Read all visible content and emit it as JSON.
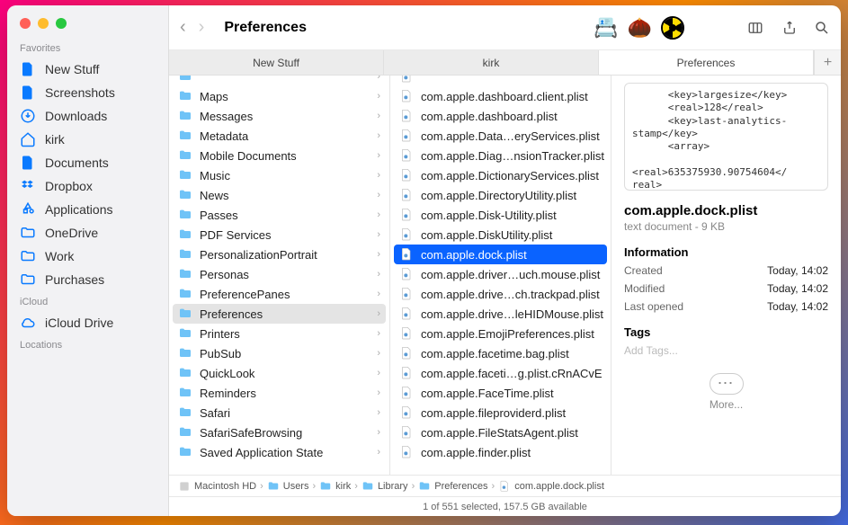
{
  "window_title": "Preferences",
  "sidebar": {
    "sections": [
      {
        "label": "Favorites",
        "items": [
          {
            "icon": "doc",
            "label": "New Stuff"
          },
          {
            "icon": "doc",
            "label": "Screenshots"
          },
          {
            "icon": "download",
            "label": "Downloads"
          },
          {
            "icon": "home",
            "label": "kirk"
          },
          {
            "icon": "doc",
            "label": "Documents"
          },
          {
            "icon": "dropbox",
            "label": "Dropbox"
          },
          {
            "icon": "app",
            "label": "Applications"
          },
          {
            "icon": "folder",
            "label": "OneDrive"
          },
          {
            "icon": "folder",
            "label": "Work"
          },
          {
            "icon": "folder",
            "label": "Purchases"
          }
        ]
      },
      {
        "label": "iCloud",
        "items": [
          {
            "icon": "cloud",
            "label": "iCloud Drive"
          }
        ]
      },
      {
        "label": "Locations",
        "items": []
      }
    ]
  },
  "toolbar": {
    "apps": [
      "scanner",
      "acorn",
      "radiation"
    ]
  },
  "tabs": [
    {
      "label": "New Stuff",
      "active": false
    },
    {
      "label": "kirk",
      "active": false
    },
    {
      "label": "Preferences",
      "active": true
    }
  ],
  "columns": {
    "folders": [
      "Maps",
      "Messages",
      "Metadata",
      "Mobile Documents",
      "Music",
      "News",
      "Passes",
      "PDF Services",
      "PersonalizationPortrait",
      "Personas",
      "PreferencePanes",
      "Preferences",
      "Printers",
      "PubSub",
      "QuickLook",
      "Reminders",
      "Safari",
      "SafariSafeBrowsing",
      "Saved Application State"
    ],
    "folders_selected_index": 11,
    "files": [
      "com.apple.dashboard.client.plist",
      "com.apple.dashboard.plist",
      "com.apple.Data…eryServices.plist",
      "com.apple.Diag…nsionTracker.plist",
      "com.apple.DictionaryServices.plist",
      "com.apple.DirectoryUtility.plist",
      "com.apple.Disk-Utility.plist",
      "com.apple.DiskUtility.plist",
      "com.apple.dock.plist",
      "com.apple.driver…uch.mouse.plist",
      "com.apple.drive…ch.trackpad.plist",
      "com.apple.drive…leHIDMouse.plist",
      "com.apple.EmojiPreferences.plist",
      "com.apple.facetime.bag.plist",
      "com.apple.faceti…g.plist.cRnACvE",
      "com.apple.FaceTime.plist",
      "com.apple.fileproviderd.plist",
      "com.apple.FileStatsAgent.plist",
      "com.apple.finder.plist"
    ],
    "files_selected_index": 8
  },
  "preview": {
    "raw": "      <key>largesize</key>\n      <real>128</real>\n      <key>last-analytics-\nstamp</key>\n      <array>\n\n<real>635375930.90754604</\nreal>\n      </array>\n      <key>last-",
    "title": "com.apple.dock.plist",
    "subtitle": "text document - 9 KB",
    "info_label": "Information",
    "created_label": "Created",
    "created_value": "Today, 14:02",
    "modified_label": "Modified",
    "modified_value": "Today, 14:02",
    "opened_label": "Last opened",
    "opened_value": "Today, 14:02",
    "tags_label": "Tags",
    "tags_placeholder": "Add Tags...",
    "more_label": "More..."
  },
  "path": [
    {
      "icon": "disk",
      "label": "Macintosh HD"
    },
    {
      "icon": "folder",
      "label": "Users"
    },
    {
      "icon": "folder",
      "label": "kirk"
    },
    {
      "icon": "folder",
      "label": "Library"
    },
    {
      "icon": "folder",
      "label": "Preferences"
    },
    {
      "icon": "file",
      "label": "com.apple.dock.plist"
    }
  ],
  "status": "1 of 551 selected, 157.5 GB available"
}
